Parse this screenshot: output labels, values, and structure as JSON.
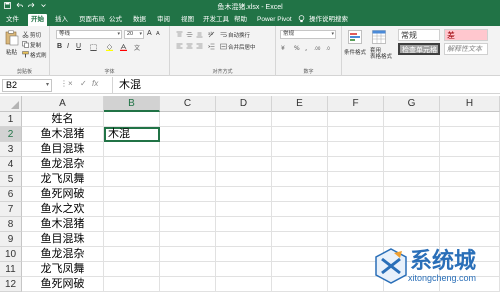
{
  "window": {
    "title": "鱼木混猪.xlsx - Excel"
  },
  "tabs": [
    {
      "label": "文件",
      "active": false
    },
    {
      "label": "开始",
      "active": true
    },
    {
      "label": "插入",
      "active": false
    },
    {
      "label": "页面布局",
      "active": false
    },
    {
      "label": "公式",
      "active": false
    },
    {
      "label": "数据",
      "active": false
    },
    {
      "label": "审阅",
      "active": false
    },
    {
      "label": "视图",
      "active": false
    },
    {
      "label": "开发工具",
      "active": false
    },
    {
      "label": "帮助",
      "active": false
    },
    {
      "label": "Power Pivot",
      "active": false
    },
    {
      "label": "操作说明搜索",
      "active": false
    }
  ],
  "ribbon": {
    "clipboard": {
      "paste": "粘贴",
      "cut": "剪切",
      "copy": "复制",
      "format_painter": "格式刷",
      "group": "剪贴板"
    },
    "font": {
      "name": "等线",
      "size": "20",
      "bold": "B",
      "italic": "I",
      "underline": "U",
      "grow": "A",
      "shrink": "A",
      "group": "字体"
    },
    "alignment": {
      "wrap": "自动换行",
      "merge": "合并后居中",
      "group": "对齐方式"
    },
    "number": {
      "format": "常规",
      "group": "数字"
    },
    "styles": {
      "conditional": "条件格式",
      "table": "套用\n表格格式",
      "normal": "常规",
      "bad": "差",
      "check": "检查单元格",
      "explanatory": "解释性文本"
    }
  },
  "formula_bar": {
    "name_box": "B2",
    "formula": "木混",
    "cancel": "×",
    "enter": "✓",
    "fx": "fx"
  },
  "columns": [
    "A",
    "B",
    "C",
    "D",
    "E",
    "F",
    "G",
    "H"
  ],
  "selected_column": "B",
  "selected_row": "2",
  "rows": [
    {
      "num": "1",
      "a": "姓名",
      "b": ""
    },
    {
      "num": "2",
      "a": "鱼木混猪",
      "b": "木混"
    },
    {
      "num": "3",
      "a": "鱼目混珠",
      "b": ""
    },
    {
      "num": "4",
      "a": "鱼龙混杂",
      "b": ""
    },
    {
      "num": "5",
      "a": "龙飞凤舞",
      "b": ""
    },
    {
      "num": "6",
      "a": "鱼死网破",
      "b": ""
    },
    {
      "num": "7",
      "a": "鱼水之欢",
      "b": ""
    },
    {
      "num": "8",
      "a": "鱼木混猪",
      "b": ""
    },
    {
      "num": "9",
      "a": "鱼目混珠",
      "b": ""
    },
    {
      "num": "10",
      "a": "鱼龙混杂",
      "b": ""
    },
    {
      "num": "11",
      "a": "龙飞凤舞",
      "b": ""
    },
    {
      "num": "12",
      "a": "鱼死网破",
      "b": ""
    }
  ],
  "watermark": {
    "brand": "系统城",
    "url": "xitongcheng.com"
  },
  "colors": {
    "excel_green": "#217346",
    "watermark_blue": "#2a6fb8"
  }
}
